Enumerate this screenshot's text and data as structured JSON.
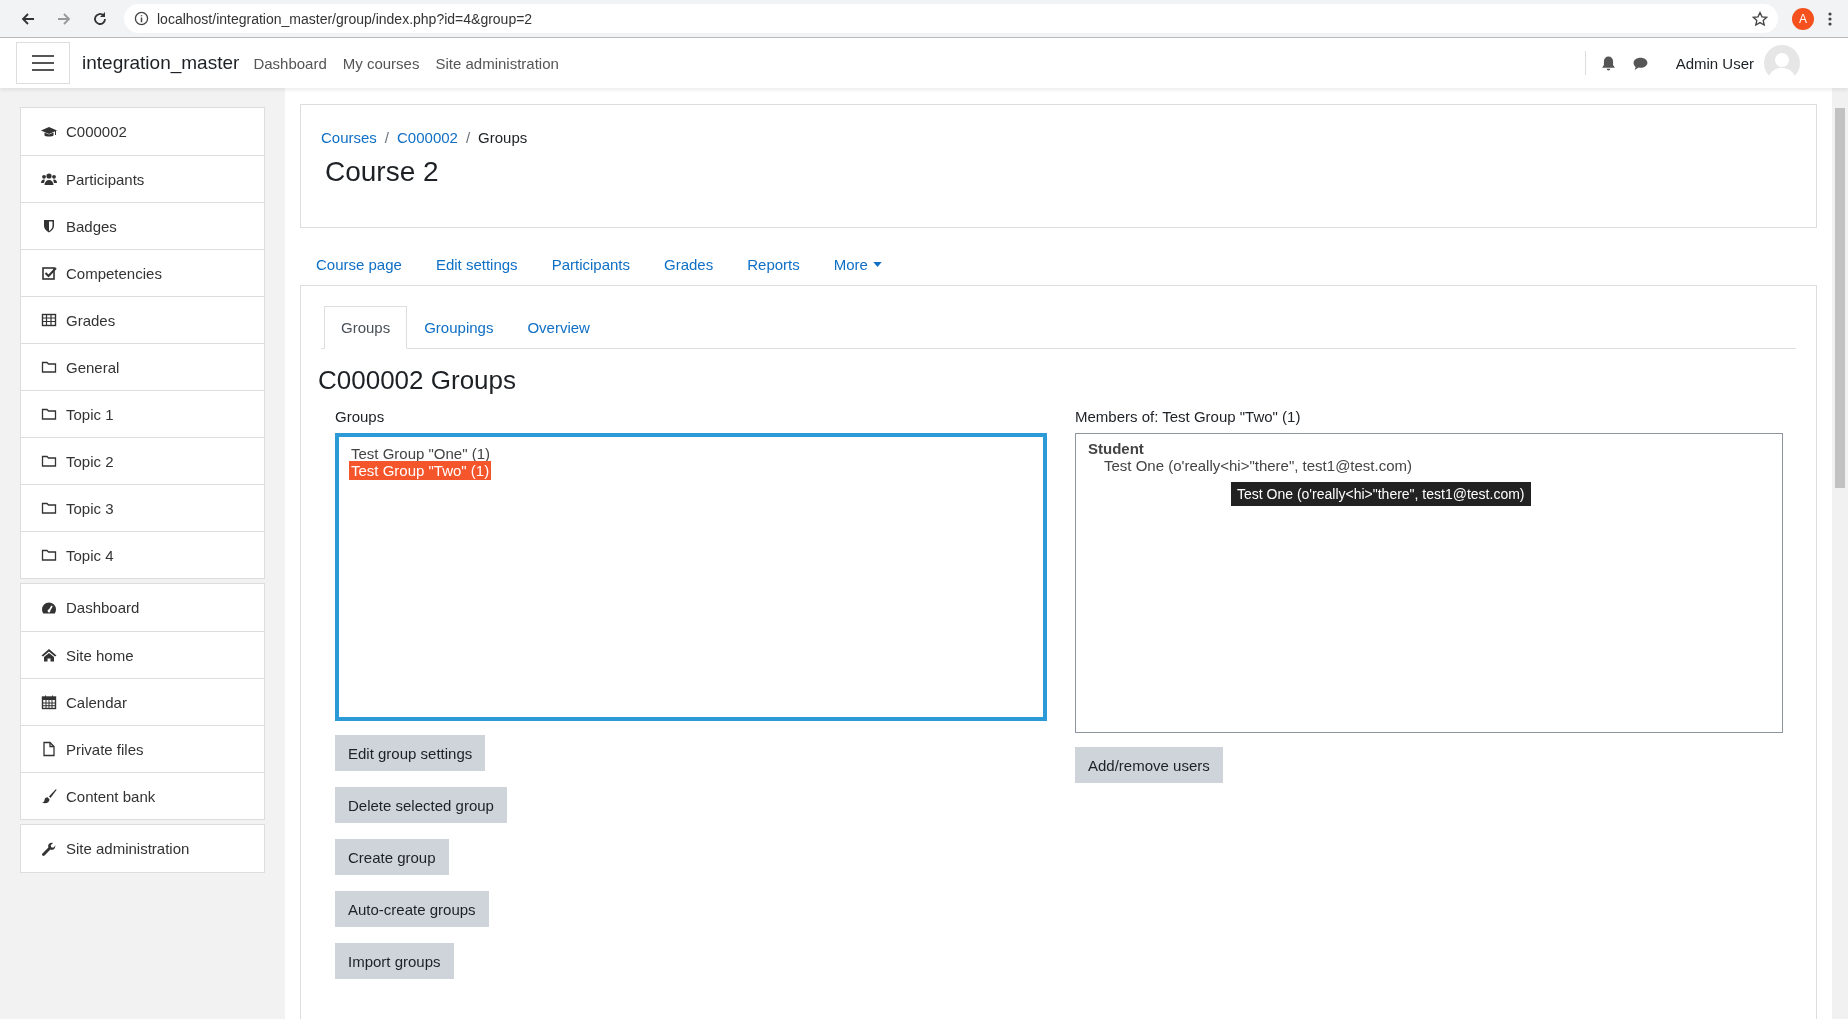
{
  "browser": {
    "url": "localhost/integration_master/group/index.php?id=4&group=2",
    "profile_initial": "A"
  },
  "navbar": {
    "site_name": "integration_master",
    "links": [
      "Dashboard",
      "My courses",
      "Site administration"
    ],
    "user_name": "Admin User"
  },
  "sidebar": {
    "sections": [
      [
        {
          "label": "C000002",
          "kind": "cap"
        },
        {
          "label": "Participants",
          "kind": "users"
        },
        {
          "label": "Badges",
          "kind": "shield"
        },
        {
          "label": "Competencies",
          "kind": "check"
        },
        {
          "label": "Grades",
          "kind": "table"
        },
        {
          "label": "General",
          "kind": "folder"
        },
        {
          "label": "Topic 1",
          "kind": "folder"
        },
        {
          "label": "Topic 2",
          "kind": "folder"
        },
        {
          "label": "Topic 3",
          "kind": "folder"
        },
        {
          "label": "Topic 4",
          "kind": "folder"
        }
      ],
      [
        {
          "label": "Dashboard",
          "kind": "gauge"
        },
        {
          "label": "Site home",
          "kind": "home"
        },
        {
          "label": "Calendar",
          "kind": "calendar"
        },
        {
          "label": "Private files",
          "kind": "file"
        },
        {
          "label": "Content bank",
          "kind": "brush"
        }
      ],
      [
        {
          "label": "Site administration",
          "kind": "wrench"
        }
      ]
    ]
  },
  "breadcrumb": [
    {
      "label": "Courses",
      "kind": "link"
    },
    {
      "label": "/",
      "kind": "separator"
    },
    {
      "label": "C000002",
      "kind": "link"
    },
    {
      "label": "/",
      "kind": "separator"
    },
    {
      "label": "Groups",
      "kind": "current"
    }
  ],
  "page_title": "Course 2",
  "course_nav": [
    {
      "label": "Course page",
      "dropdown": false
    },
    {
      "label": "Edit settings",
      "dropdown": false
    },
    {
      "label": "Participants",
      "dropdown": false
    },
    {
      "label": "Grades",
      "dropdown": false
    },
    {
      "label": "Reports",
      "dropdown": false
    },
    {
      "label": "More",
      "dropdown": true
    }
  ],
  "tabs": [
    {
      "label": "Groups",
      "selected": true
    },
    {
      "label": "Groupings",
      "selected": false
    },
    {
      "label": "Overview",
      "selected": false
    }
  ],
  "heading": "C000002 Groups",
  "groups": {
    "label": "Groups",
    "options": [
      {
        "label": "Test Group \"One\" (1)",
        "selected": false
      },
      {
        "label": "Test Group \"Two\" (1)",
        "selected": true
      }
    ],
    "buttons": [
      "Edit group settings",
      "Delete selected group",
      "Create group",
      "Auto-create groups",
      "Import groups"
    ]
  },
  "members": {
    "label": "Members of: Test Group \"Two\" (1)",
    "roles": [
      {
        "role": "Student",
        "members": [
          "Test One (o'really<hi>\"there\", test1@test.com)"
        ]
      }
    ],
    "button": "Add/remove users"
  },
  "tooltip": "Test One (o'really<hi>\"there\", test1@test.com)"
}
